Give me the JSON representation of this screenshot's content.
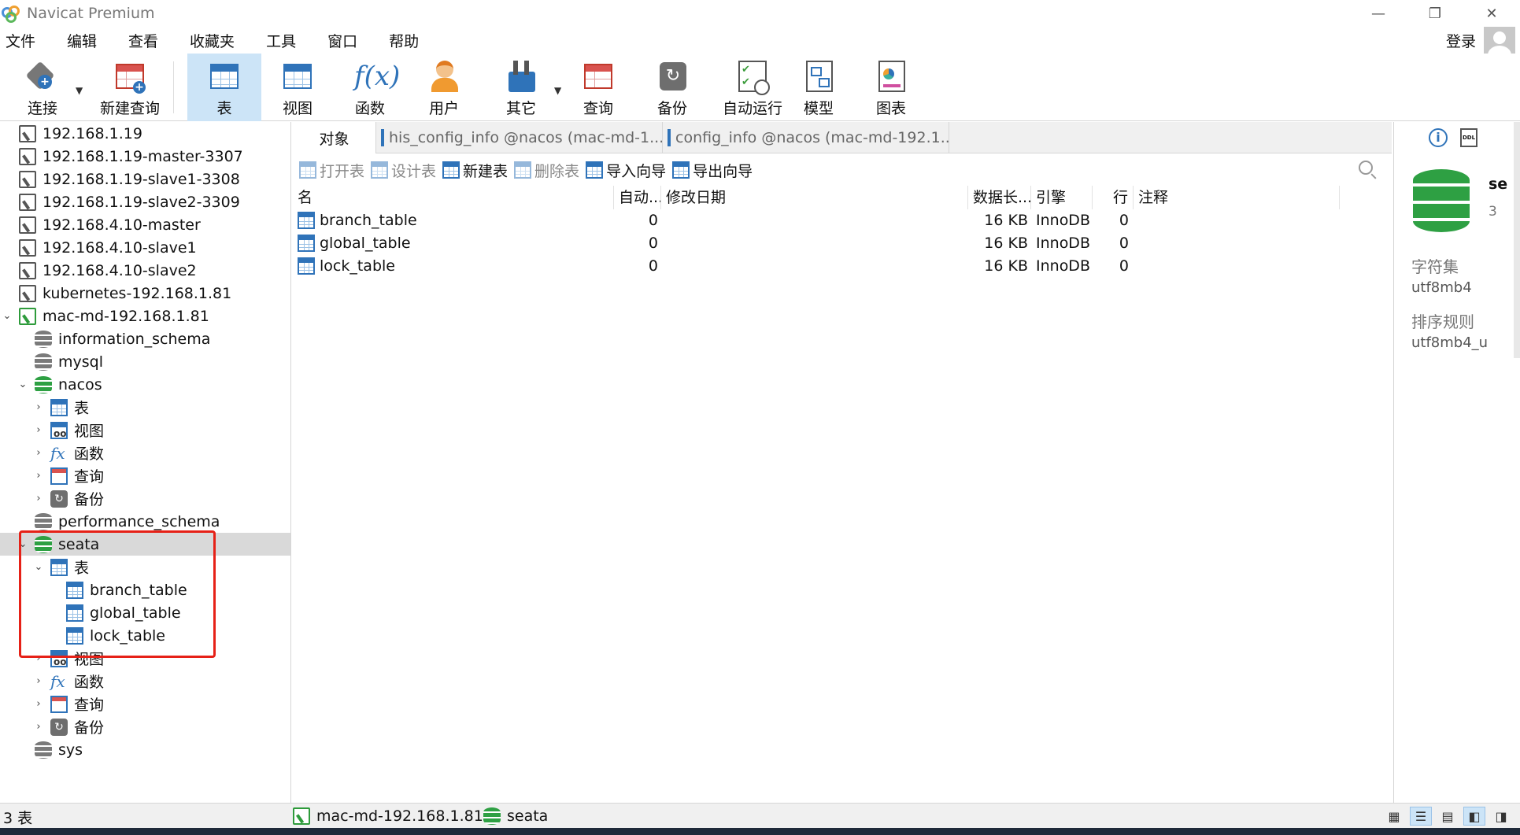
{
  "window": {
    "title": "Navicat Premium"
  },
  "menu": [
    "文件",
    "编辑",
    "查看",
    "收藏夹",
    "工具",
    "窗口",
    "帮助"
  ],
  "login": "登录",
  "toolbar": [
    {
      "label": "连接",
      "icon": "connection-icon"
    },
    {
      "label": "新建查询",
      "icon": "new-query-icon"
    },
    {
      "label": "表",
      "icon": "table-icon",
      "active": true
    },
    {
      "label": "视图",
      "icon": "view-icon"
    },
    {
      "label": "函数",
      "icon": "function-icon"
    },
    {
      "label": "用户",
      "icon": "user-icon"
    },
    {
      "label": "其它",
      "icon": "tools-icon"
    },
    {
      "label": "查询",
      "icon": "query-icon"
    },
    {
      "label": "备份",
      "icon": "backup-icon"
    },
    {
      "label": "自动运行",
      "icon": "schedule-icon"
    },
    {
      "label": "模型",
      "icon": "model-icon"
    },
    {
      "label": "图表",
      "icon": "chart-icon"
    }
  ],
  "tree": {
    "connections": [
      "192.168.1.19",
      "192.168.1.19-master-3307",
      "192.168.1.19-slave1-3308",
      "192.168.1.19-slave2-3309",
      "192.168.4.10-master",
      "192.168.4.10-slave1",
      "192.168.4.10-slave2",
      "kubernetes-192.168.1.81"
    ],
    "open_connection": "mac-md-192.168.1.81",
    "databases": {
      "information_schema": "information_schema",
      "mysql": "mysql",
      "nacos": "nacos",
      "performance_schema": "performance_schema",
      "seata": "seata",
      "sys": "sys"
    },
    "nodes": {
      "tables": "表",
      "views": "视图",
      "functions": "函数",
      "queries": "查询",
      "backups": "备份"
    },
    "seata_tables": [
      "branch_table",
      "global_table",
      "lock_table"
    ]
  },
  "tabs": [
    {
      "label": "对象"
    },
    {
      "label": "his_config_info @nacos (mac-md-1..."
    },
    {
      "label": "config_info @nacos (mac-md-192.1..."
    }
  ],
  "object_toolbar": {
    "open_table": "打开表",
    "design_table": "设计表",
    "new_table": "新建表",
    "delete_table": "删除表",
    "import_wizard": "导入向导",
    "export_wizard": "导出向导"
  },
  "grid": {
    "columns": [
      "名",
      "自动...",
      "修改日期",
      "数据长...",
      "引擎",
      "行",
      "注释"
    ],
    "rows": [
      {
        "name": "branch_table",
        "auto": "0",
        "modified": "",
        "size": "16 KB",
        "engine": "InnoDB",
        "rows": "0",
        "comment": ""
      },
      {
        "name": "global_table",
        "auto": "0",
        "modified": "",
        "size": "16 KB",
        "engine": "InnoDB",
        "rows": "0",
        "comment": ""
      },
      {
        "name": "lock_table",
        "auto": "0",
        "modified": "",
        "size": "16 KB",
        "engine": "InnoDB",
        "rows": "0",
        "comment": ""
      }
    ]
  },
  "info": {
    "name": "se",
    "count": "3",
    "charset_label": "字符集",
    "charset_value": "utf8mb4",
    "collation_label": "排序规则",
    "collation_value": "utf8mb4_u"
  },
  "status": {
    "count": "3 表",
    "connection": "mac-md-192.168.1.81",
    "database": "seata"
  },
  "colors": {
    "accent": "#2f73b9",
    "active_tab": "#cce4f7",
    "highlight": "#e62117",
    "db_green": "#2ea043"
  }
}
